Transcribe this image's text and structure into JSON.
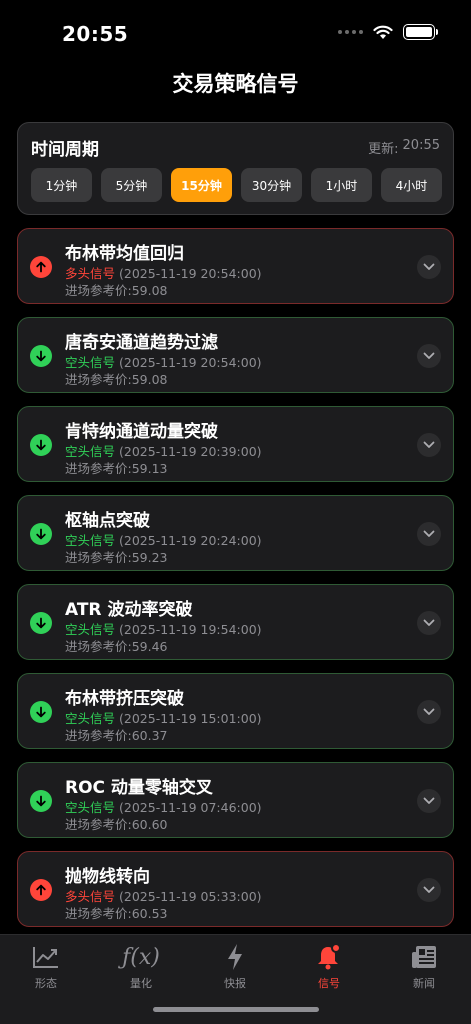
{
  "status_bar": {
    "time": "20:55"
  },
  "page_title": "交易策略信号",
  "period": {
    "title": "时间周期",
    "updated_label": "更新:",
    "updated_time": "20:55",
    "options": [
      "1分钟",
      "5分钟",
      "15分钟",
      "30分钟",
      "1小时",
      "4小时"
    ],
    "selected": "15分钟"
  },
  "signals": [
    {
      "name": "布林带均值回归",
      "type": "多头信号",
      "direction": "long",
      "time": "(2025-11-19 20:54:00)",
      "price_label": "进场参考价:",
      "price": "59.08"
    },
    {
      "name": "唐奇安通道趋势过滤",
      "type": "空头信号",
      "direction": "short",
      "time": "(2025-11-19 20:54:00)",
      "price_label": "进场参考价:",
      "price": "59.08"
    },
    {
      "name": "肯特纳通道动量突破",
      "type": "空头信号",
      "direction": "short",
      "time": "(2025-11-19 20:39:00)",
      "price_label": "进场参考价:",
      "price": "59.13"
    },
    {
      "name": "枢轴点突破",
      "type": "空头信号",
      "direction": "short",
      "time": "(2025-11-19 20:24:00)",
      "price_label": "进场参考价:",
      "price": "59.23"
    },
    {
      "name": "ATR 波动率突破",
      "type": "空头信号",
      "direction": "short",
      "time": "(2025-11-19 19:54:00)",
      "price_label": "进场参考价:",
      "price": "59.46"
    },
    {
      "name": "布林带挤压突破",
      "type": "空头信号",
      "direction": "short",
      "time": "(2025-11-19 15:01:00)",
      "price_label": "进场参考价:",
      "price": "60.37"
    },
    {
      "name": "ROC 动量零轴交叉",
      "type": "空头信号",
      "direction": "short",
      "time": "(2025-11-19 07:46:00)",
      "price_label": "进场参考价:",
      "price": "60.60"
    },
    {
      "name": "抛物线转向",
      "type": "多头信号",
      "direction": "long",
      "time": "(2025-11-19 05:33:00)",
      "price_label": "进场参考价:",
      "price": "60.53"
    }
  ],
  "tabs": [
    {
      "label": "形态",
      "icon": "chart-line-icon"
    },
    {
      "label": "量化",
      "icon": "function-icon"
    },
    {
      "label": "快报",
      "icon": "bolt-icon"
    },
    {
      "label": "信号",
      "icon": "bell-icon",
      "active": true
    },
    {
      "label": "新闻",
      "icon": "newspaper-icon"
    }
  ],
  "colors": {
    "accent": "#ff9f0a",
    "long": "#ff453a",
    "short": "#30d158",
    "active_tab": "#ff453a"
  }
}
